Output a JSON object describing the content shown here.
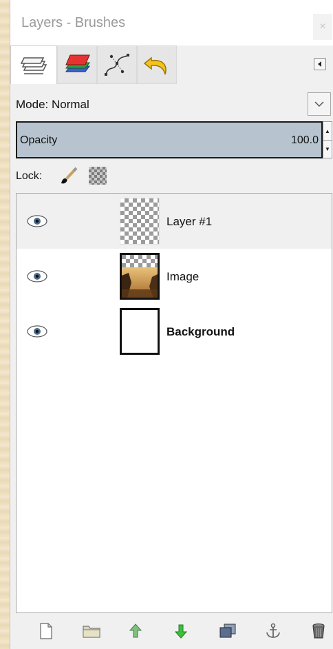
{
  "window": {
    "title": "Layers - Brushes",
    "close_glyph": "×"
  },
  "tabs": [
    {
      "id": "layers",
      "icon": "layers-icon",
      "active": true
    },
    {
      "id": "channels",
      "icon": "channels-icon",
      "active": false
    },
    {
      "id": "paths",
      "icon": "paths-icon",
      "active": false
    },
    {
      "id": "undo-history",
      "icon": "undo-history-icon",
      "active": false
    }
  ],
  "mode": {
    "label": "Mode: Normal"
  },
  "opacity": {
    "label": "Opacity",
    "value": "100.0"
  },
  "lock": {
    "label": "Lock:"
  },
  "layers": [
    {
      "name": "Layer #1",
      "thumbnail": "transparent",
      "selected": true,
      "bold": false
    },
    {
      "name": "Image",
      "thumbnail": "photo",
      "selected": false,
      "bold": false
    },
    {
      "name": "Background",
      "thumbnail": "white",
      "selected": false,
      "bold": true
    }
  ],
  "bottom_toolbar": [
    "new-layer-icon",
    "layer-group-icon",
    "raise-layer-icon",
    "lower-layer-icon",
    "duplicate-layer-icon",
    "anchor-layer-icon",
    "delete-layer-icon"
  ],
  "colors": {
    "opacity_fill": "#b7c4cf",
    "selected_row": "#f0f0f0",
    "raise_arrow": "#4caf50",
    "lower_arrow": "#2e9b2e"
  }
}
